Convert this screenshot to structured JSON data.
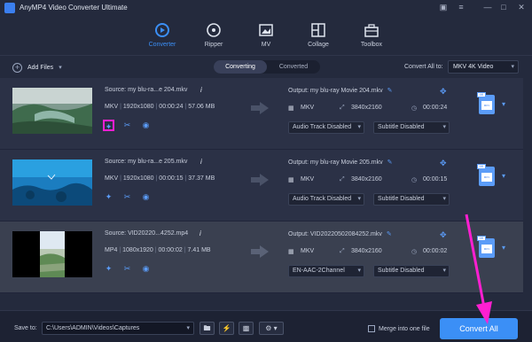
{
  "app": {
    "title": "AnyMP4 Video Converter Ultimate"
  },
  "nav": {
    "tabs": [
      {
        "label": "Converter",
        "icon": "converter-icon",
        "active": true
      },
      {
        "label": "Ripper",
        "icon": "ripper-icon",
        "active": false
      },
      {
        "label": "MV",
        "icon": "mv-icon",
        "active": false
      },
      {
        "label": "Collage",
        "icon": "collage-icon",
        "active": false
      },
      {
        "label": "Toolbox",
        "icon": "toolbox-icon",
        "active": false
      }
    ]
  },
  "toolbar": {
    "add_files": "Add Files",
    "tab_converting": "Converting",
    "tab_converted": "Converted",
    "convert_all_to_label": "Convert All to:",
    "convert_all_to_value": "MKV 4K Video"
  },
  "files": [
    {
      "source": "Source: my blu-ra...e 204.mkv",
      "format": "MKV",
      "resolution": "1920x1080",
      "duration": "00:00:24",
      "size": "57.06 MB",
      "output": "Output: my blu-ray Movie 204.mkv",
      "out_format": "MKV",
      "out_resolution": "3840x2160",
      "out_duration": "00:00:24",
      "audio": "Audio Track Disabled",
      "subtitle": "Subtitle Disabled"
    },
    {
      "source": "Source: my blu-ra...e 205.mkv",
      "format": "MKV",
      "resolution": "1920x1080",
      "duration": "00:00:15",
      "size": "37.37 MB",
      "output": "Output: my blu-ray Movie 205.mkv",
      "out_format": "MKV",
      "out_resolution": "3840x2160",
      "out_duration": "00:00:15",
      "audio": "Audio Track Disabled",
      "subtitle": "Subtitle Disabled"
    },
    {
      "source": "Source: VID20220...4252.mp4",
      "format": "MP4",
      "resolution": "1080x1920",
      "duration": "00:00:02",
      "size": "7.41 MB",
      "output": "Output: VID20220502084252.mkv",
      "out_format": "MKV",
      "out_resolution": "3840x2160",
      "out_duration": "00:00:02",
      "audio": "EN-AAC-2Channel",
      "subtitle": "Subtitle Disabled"
    }
  ],
  "footer": {
    "save_to_label": "Save to:",
    "save_path": "C:\\Users\\ADMIN\\Videos\\Captures",
    "merge_label": "Merge into one file",
    "convert_all": "Convert All"
  },
  "colors": {
    "accent": "#3b8ff6",
    "highlight": "#ff1fd1",
    "background": "#242a3d"
  }
}
